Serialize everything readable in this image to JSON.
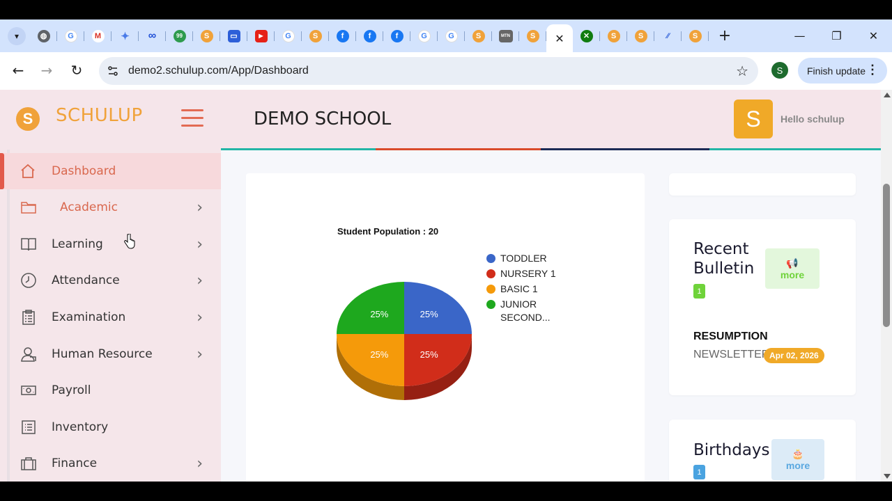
{
  "browser": {
    "tab_icons": [
      "globe-icon",
      "google-icon",
      "gmail-icon",
      "gemini-icon",
      "meta-icon",
      "badge-icon",
      "schulup-icon",
      "app-icon",
      "youtube-icon",
      "google-icon",
      "schulup-icon",
      "facebook-icon",
      "facebook-icon",
      "facebook-icon",
      "google-icon",
      "google-icon",
      "schulup-icon",
      "mtn-icon",
      "schulup-icon"
    ],
    "active_tab_close": "✕",
    "url": "demo2.schulup.com/App/Dashboard",
    "profile_initial": "S",
    "finish_update_label": "Finish update"
  },
  "header": {
    "logo_letter": "S",
    "brand": "SCHULUP",
    "school_name": "DEMO SCHOOL",
    "avatar_letter": "S",
    "greeting": "Hello schulup"
  },
  "sidebar": {
    "items": [
      {
        "label": "Dashboard",
        "icon": "home-icon",
        "has_chevron": false
      },
      {
        "label": "Academic",
        "icon": "folder-icon",
        "has_chevron": true
      },
      {
        "label": "Learning",
        "icon": "book-icon",
        "has_chevron": true
      },
      {
        "label": "Attendance",
        "icon": "clock-icon",
        "has_chevron": true
      },
      {
        "label": "Examination",
        "icon": "clipboard-icon",
        "has_chevron": true
      },
      {
        "label": "Human Resource",
        "icon": "person-icon",
        "has_chevron": true
      },
      {
        "label": "Payroll",
        "icon": "cash-icon",
        "has_chevron": false
      },
      {
        "label": "Inventory",
        "icon": "list-icon",
        "has_chevron": false
      },
      {
        "label": "Finance",
        "icon": "briefcase-icon",
        "has_chevron": true
      }
    ]
  },
  "colors": {
    "brand_orange": "#f0a23a",
    "accent_red": "#e2594a",
    "bar_teal": "#22b5a6",
    "bar_red": "#d94a2a",
    "bar_navy": "#1b2a55",
    "bar_teal2": "#22b5a6"
  },
  "chart_data": {
    "type": "pie",
    "title": "Student Population : 20",
    "series": [
      {
        "name": "TODDLER",
        "value": 25,
        "label": "25%",
        "color": "#3a66c8"
      },
      {
        "name": "NURSERY 1",
        "value": 25,
        "label": "25%",
        "color": "#d12d1a"
      },
      {
        "name": "BASIC 1",
        "value": 25,
        "label": "25%",
        "color": "#f59a0a"
      },
      {
        "name": "JUNIOR SECOND...",
        "value": 25,
        "label": "25%",
        "color": "#1ea81e"
      }
    ],
    "legend": "right"
  },
  "bulletin": {
    "heading_line1": "Recent",
    "heading_line2": "Bulletin",
    "count": "1",
    "more_label": "more",
    "item_title": "RESUMPTION",
    "item_sub": "NEWSLETTER",
    "item_date": "Apr 02, 2026"
  },
  "birthdays": {
    "heading": "Birthdays",
    "count": "1",
    "more_label": "more"
  }
}
